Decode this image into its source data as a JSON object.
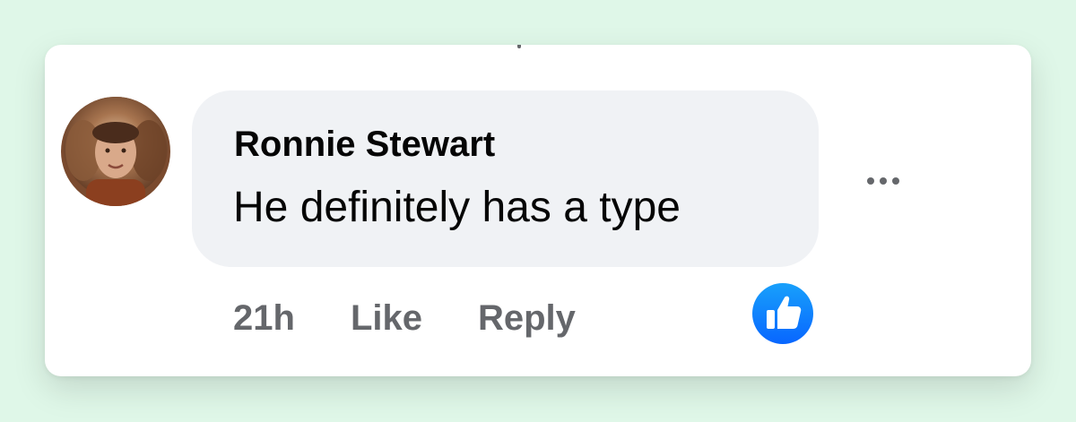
{
  "comment": {
    "author": "Ronnie Stewart",
    "text": "He definitely has a type",
    "timestamp": "21h",
    "like_label": "Like",
    "reply_label": "Reply",
    "reaction": "like-reaction-icon"
  },
  "icons": {
    "more": "more-options-icon",
    "reaction": "thumbs-up-icon"
  },
  "colors": {
    "page_background": "#dff7e8",
    "card_background": "#ffffff",
    "bubble_background": "#f0f2f5",
    "text_primary": "#050505",
    "text_secondary": "#65676b",
    "reaction_blue": "#1877f2"
  }
}
